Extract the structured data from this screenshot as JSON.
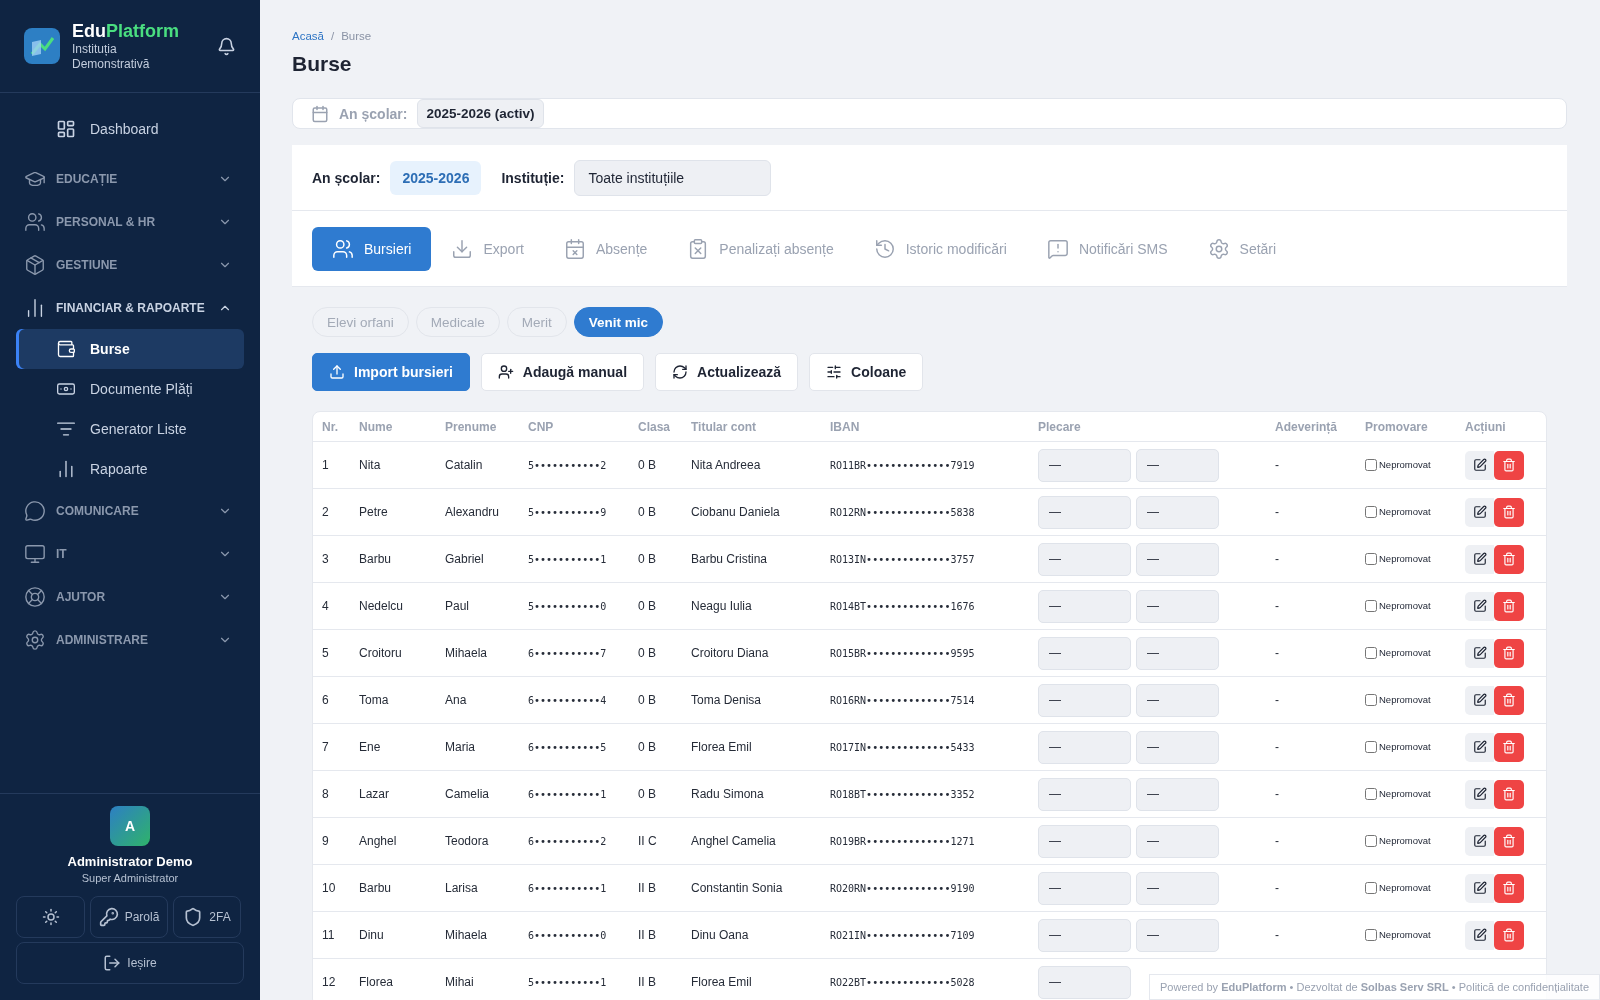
{
  "brand": {
    "name_first": "Edu",
    "name_second": "Platform",
    "institution": "Instituția Demonstrativă"
  },
  "sidebar": {
    "items": [
      {
        "kind": "link",
        "label": "Dashboard",
        "selected": false
      },
      {
        "kind": "section",
        "label": "EDUCAȚIE",
        "expanded": false
      },
      {
        "kind": "section",
        "label": "PERSONAL & HR",
        "expanded": false
      },
      {
        "kind": "section",
        "label": "GESTIUNE",
        "expanded": false
      },
      {
        "kind": "section",
        "label": "FINANCIAR & RAPOARTE",
        "expanded": true,
        "children": [
          {
            "label": "Burse",
            "selected": true
          },
          {
            "label": "Documente Plăți",
            "selected": false
          },
          {
            "label": "Generator Liste",
            "selected": false
          },
          {
            "label": "Rapoarte",
            "selected": false
          }
        ]
      },
      {
        "kind": "section",
        "label": "COMUNICARE",
        "expanded": false
      },
      {
        "kind": "section",
        "label": "IT",
        "expanded": false
      },
      {
        "kind": "section",
        "label": "AJUTOR",
        "expanded": false
      },
      {
        "kind": "section",
        "label": "ADMINISTRARE",
        "expanded": false
      }
    ]
  },
  "user": {
    "initial": "A",
    "name": "Administrator Demo",
    "role": "Super Administrator",
    "buttons": [
      "Parolă",
      "2FA"
    ],
    "logout": "Ieșire"
  },
  "breadcrumb": [
    "Acasă",
    "Burse"
  ],
  "breadcrumb_separator": "/",
  "page_title": "Burse",
  "year_bar": {
    "label": "An școlar:",
    "value": "2025-2026 (activ)"
  },
  "filters": {
    "year_label": "An școlar:",
    "year_value": "2025-2026",
    "institution_label": "Instituție:",
    "institution_value": "Toate instituțiile"
  },
  "tabs": [
    {
      "label": "Bursieri",
      "selected": true
    },
    {
      "label": "Export",
      "selected": false
    },
    {
      "label": "Absențe",
      "selected": false
    },
    {
      "label": "Penalizați absențe",
      "selected": false
    },
    {
      "label": "Istoric modificări",
      "selected": false
    },
    {
      "label": "Notificări SMS",
      "selected": false
    },
    {
      "label": "Setări",
      "selected": false
    }
  ],
  "categories": [
    {
      "label": "Elevi orfani",
      "selected": false
    },
    {
      "label": "Medicale",
      "selected": false
    },
    {
      "label": "Merit",
      "selected": false
    },
    {
      "label": "Venit mic",
      "selected": true
    }
  ],
  "actions": [
    {
      "label": "Import bursieri",
      "kind": "primary"
    },
    {
      "label": "Adaugă manual",
      "kind": "secondary"
    },
    {
      "label": "Actualizează",
      "kind": "secondary"
    },
    {
      "label": "Coloane",
      "kind": "secondary"
    }
  ],
  "table": {
    "columns": [
      "Nr.",
      "Nume",
      "Prenume",
      "CNP",
      "Clasa",
      "Titular cont",
      "IBAN",
      "Plecare",
      "Adeverință",
      "Promovare",
      "Acțiuni"
    ],
    "rows": [
      {
        "nr": "1",
        "nume": "Nita",
        "prenume": "Catalin",
        "cnp": "5•••••••••••2",
        "clasa": "0 B",
        "titular": "Nita Andreea",
        "iban": "RO11BR••••••••••••••7919",
        "plecare": [
          "—",
          "—"
        ],
        "adeverinta": "-",
        "promovat": false,
        "promovare_label": "Nepromovat"
      },
      {
        "nr": "2",
        "nume": "Petre",
        "prenume": "Alexandru",
        "cnp": "5•••••••••••9",
        "clasa": "0 B",
        "titular": "Ciobanu Daniela",
        "iban": "RO12RN••••••••••••••5838",
        "plecare": [
          "—",
          "—"
        ],
        "adeverinta": "-",
        "promovat": false,
        "promovare_label": "Nepromovat"
      },
      {
        "nr": "3",
        "nume": "Barbu",
        "prenume": "Gabriel",
        "cnp": "5•••••••••••1",
        "clasa": "0 B",
        "titular": "Barbu Cristina",
        "iban": "RO13IN••••••••••••••3757",
        "plecare": [
          "—",
          "—"
        ],
        "adeverinta": "-",
        "promovat": false,
        "promovare_label": "Nepromovat"
      },
      {
        "nr": "4",
        "nume": "Nedelcu",
        "prenume": "Paul",
        "cnp": "5•••••••••••0",
        "clasa": "0 B",
        "titular": "Neagu Iulia",
        "iban": "RO14BT••••••••••••••1676",
        "plecare": [
          "—",
          "—"
        ],
        "adeverinta": "-",
        "promovat": false,
        "promovare_label": "Nepromovat"
      },
      {
        "nr": "5",
        "nume": "Croitoru",
        "prenume": "Mihaela",
        "cnp": "6•••••••••••7",
        "clasa": "0 B",
        "titular": "Croitoru Diana",
        "iban": "RO15BR••••••••••••••9595",
        "plecare": [
          "—",
          "—"
        ],
        "adeverinta": "-",
        "promovat": false,
        "promovare_label": "Nepromovat"
      },
      {
        "nr": "6",
        "nume": "Toma",
        "prenume": "Ana",
        "cnp": "6•••••••••••4",
        "clasa": "0 B",
        "titular": "Toma Denisa",
        "iban": "RO16RN••••••••••••••7514",
        "plecare": [
          "—",
          "—"
        ],
        "adeverinta": "-",
        "promovat": false,
        "promovare_label": "Nepromovat"
      },
      {
        "nr": "7",
        "nume": "Ene",
        "prenume": "Maria",
        "cnp": "6•••••••••••5",
        "clasa": "0 B",
        "titular": "Florea Emil",
        "iban": "RO17IN••••••••••••••5433",
        "plecare": [
          "—",
          "—"
        ],
        "adeverinta": "-",
        "promovat": false,
        "promovare_label": "Nepromovat"
      },
      {
        "nr": "8",
        "nume": "Lazar",
        "prenume": "Camelia",
        "cnp": "6•••••••••••1",
        "clasa": "0 B",
        "titular": "Radu Simona",
        "iban": "RO18BT••••••••••••••3352",
        "plecare": [
          "—",
          "—"
        ],
        "adeverinta": "-",
        "promovat": false,
        "promovare_label": "Nepromovat"
      },
      {
        "nr": "9",
        "nume": "Anghel",
        "prenume": "Teodora",
        "cnp": "6•••••••••••2",
        "clasa": "II C",
        "titular": "Anghel Camelia",
        "iban": "RO19BR••••••••••••••1271",
        "plecare": [
          "—",
          "—"
        ],
        "adeverinta": "-",
        "promovat": false,
        "promovare_label": "Nepromovat"
      },
      {
        "nr": "10",
        "nume": "Barbu",
        "prenume": "Larisa",
        "cnp": "6•••••••••••1",
        "clasa": "II B",
        "titular": "Constantin Sonia",
        "iban": "RO20RN••••••••••••••9190",
        "plecare": [
          "—",
          "—"
        ],
        "adeverinta": "-",
        "promovat": false,
        "promovare_label": "Nepromovat"
      },
      {
        "nr": "11",
        "nume": "Dinu",
        "prenume": "Mihaela",
        "cnp": "6•••••••••••0",
        "clasa": "II B",
        "titular": "Dinu Oana",
        "iban": "RO21IN••••••••••••••7109",
        "plecare": [
          "—",
          "—"
        ],
        "adeverinta": "-",
        "promovat": false,
        "promovare_label": "Nepromovat"
      },
      {
        "nr": "12",
        "nume": "Florea",
        "prenume": "Mihai",
        "cnp": "5•••••••••••1",
        "clasa": "II B",
        "titular": "Florea Emil",
        "iban": "RO22BT••••••••••••••5028",
        "plecare": [
          "—"
        ]
      }
    ]
  },
  "footer": "Powered by **EduPlatform** • Dezvoltat de **Solbas Serv SRL** • Politică de confidențialitate"
}
